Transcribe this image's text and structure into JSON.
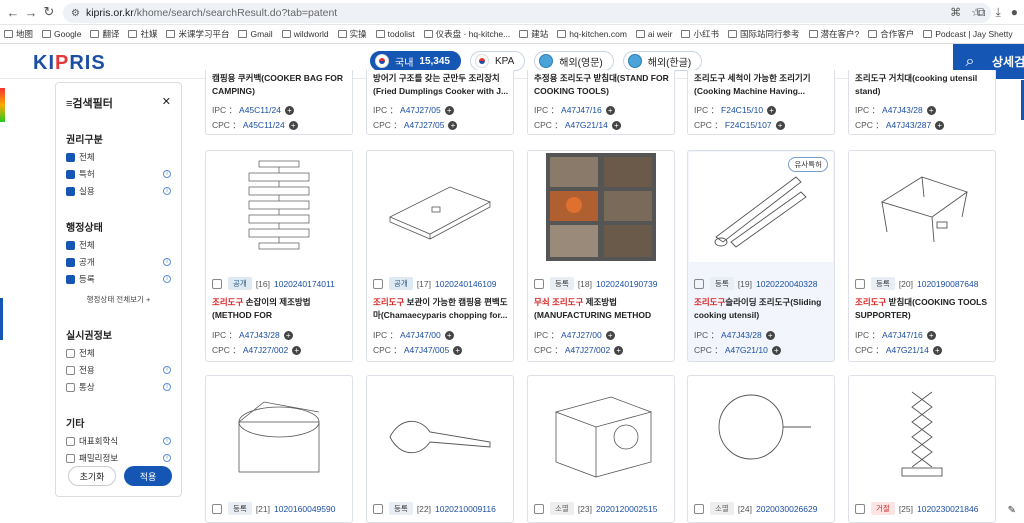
{
  "browser": {
    "url_host": "kipris.or.kr",
    "url_path": "/khome/search/searchResult.do?tab=patent",
    "bookmarks": [
      "地图",
      "Google",
      "翻译",
      "社媒",
      "米课学习平台",
      "Gmail",
      "wildworld",
      "实操",
      "todolist",
      "仪表盘 · hq-kitche...",
      "建站",
      "hq-kitchen.com",
      "ai weir",
      "小红书",
      "国际站同行参考",
      "潜在客户?",
      "合作客户",
      "Podcast | Jay Shetty"
    ]
  },
  "header": {
    "logo_pre": "KI",
    "logo_mid": "P",
    "logo_post": "RIS",
    "tabs": [
      {
        "label": "국내",
        "count": "15,345",
        "active": true
      },
      {
        "label": "KPA",
        "count": "",
        "active": false
      },
      {
        "label": "해외(영문)",
        "count": "",
        "active": false
      },
      {
        "label": "해외(한글)",
        "count": "",
        "active": false
      }
    ],
    "detail_label": "상세검"
  },
  "sidebar": {
    "title": "검색필터",
    "sections": [
      {
        "title": "권리구분",
        "items": [
          {
            "label": "전체",
            "checked": true
          },
          {
            "label": "특허",
            "checked": true,
            "info": true
          },
          {
            "label": "실용",
            "checked": true,
            "info": true
          }
        ]
      },
      {
        "title": "행정상태",
        "items": [
          {
            "label": "전체",
            "checked": true
          },
          {
            "label": "공개",
            "checked": true,
            "info": true
          },
          {
            "label": "등록",
            "checked": true,
            "info": true
          }
        ],
        "more": "행정상태 전체보기 +"
      },
      {
        "title": "실시권정보",
        "items": [
          {
            "label": "전체",
            "checked": false
          },
          {
            "label": "전용",
            "checked": false,
            "info": true
          },
          {
            "label": "통상",
            "checked": false,
            "info": true
          }
        ]
      },
      {
        "title": "기타",
        "items": [
          {
            "label": "대표회학식",
            "checked": false,
            "info": true
          },
          {
            "label": "패밀리정보",
            "checked": false,
            "info": true
          }
        ]
      }
    ],
    "reset_label": "초기화",
    "apply_label": "적용"
  },
  "top_row": [
    {
      "title": "캠핑용 쿠커백(COOKER BAG FOR CAMPING)",
      "ipc": "A45C11/24",
      "cpc": "A45C11/24"
    },
    {
      "title": "방어기 구조를 갖는 군만두 조리장치(Fried Dumplings Cooker with J...",
      "ipc": "A47J27/05",
      "cpc": "A47J27/05"
    },
    {
      "title": "추정용 조리도구 받침대(STAND FOR COOKING TOOLS)",
      "ipc": "A47J47/16",
      "cpc": "A47G21/14"
    },
    {
      "title": "조리도구 세척이 가능한 조리기기(Cooking Machine Having...",
      "ipc": "F24C15/10",
      "cpc": "F24C15/107"
    },
    {
      "title": "조리도구 거치대(cooking utensil stand)",
      "ipc": "A47J43/28",
      "cpc": "A47J43/287"
    }
  ],
  "middle_row": [
    {
      "status": "공개",
      "num": "[16]",
      "appno": "1020240174011",
      "hl": "조리도구",
      "title": " 손잡이의 제조방법(METHOD FOR MANUFACTURING KITCHE...",
      "ipc": "A47J43/28",
      "cpc": "A47J27/002",
      "badge": ""
    },
    {
      "status": "공개",
      "num": "[17]",
      "appno": "1020240146109",
      "hl": "조리도구",
      "title": " 보관이 가능한 캠핑용 편백도마(Chamaecyparis chopping for...",
      "ipc": "A47J47/00",
      "cpc": "A47J47/005",
      "badge": ""
    },
    {
      "status": "등록",
      "num": "[18]",
      "appno": "1020240190739",
      "hl": "무쇠 조리도구",
      "title": " 제조방법(MANUFACTURING METHOD OF...",
      "ipc": "A47J27/00",
      "cpc": "A47J27/002",
      "badge": ""
    },
    {
      "status": "등록",
      "num": "[19]",
      "appno": "1020220040328",
      "hl": "조리도구",
      "title": "슬라이딩 조리도구(Sliding cooking utensil)",
      "ipc": "A47J43/28",
      "cpc": "A47G21/10",
      "badge": "유사특허"
    },
    {
      "status": "등록",
      "num": "[20]",
      "appno": "1020190087648",
      "hl": "조리도구",
      "title": " 받침대(COOKING TOOLS SUPPORTER)",
      "ipc": "A47J47/16",
      "cpc": "A47G21/14",
      "badge": ""
    }
  ],
  "bottom_row": [
    {
      "status": "등록",
      "num": "[21]",
      "appno": "1020160049590"
    },
    {
      "status": "등록",
      "num": "[22]",
      "appno": "1020210009116"
    },
    {
      "status": "소멸",
      "num": "[23]",
      "appno": "2020120002515"
    },
    {
      "status": "소멸",
      "num": "[24]",
      "appno": "2020030026629"
    },
    {
      "status": "거절",
      "num": "[25]",
      "appno": "1020230021846"
    }
  ],
  "labels": {
    "ipc": "IPC ：",
    "cpc": "CPC ："
  }
}
